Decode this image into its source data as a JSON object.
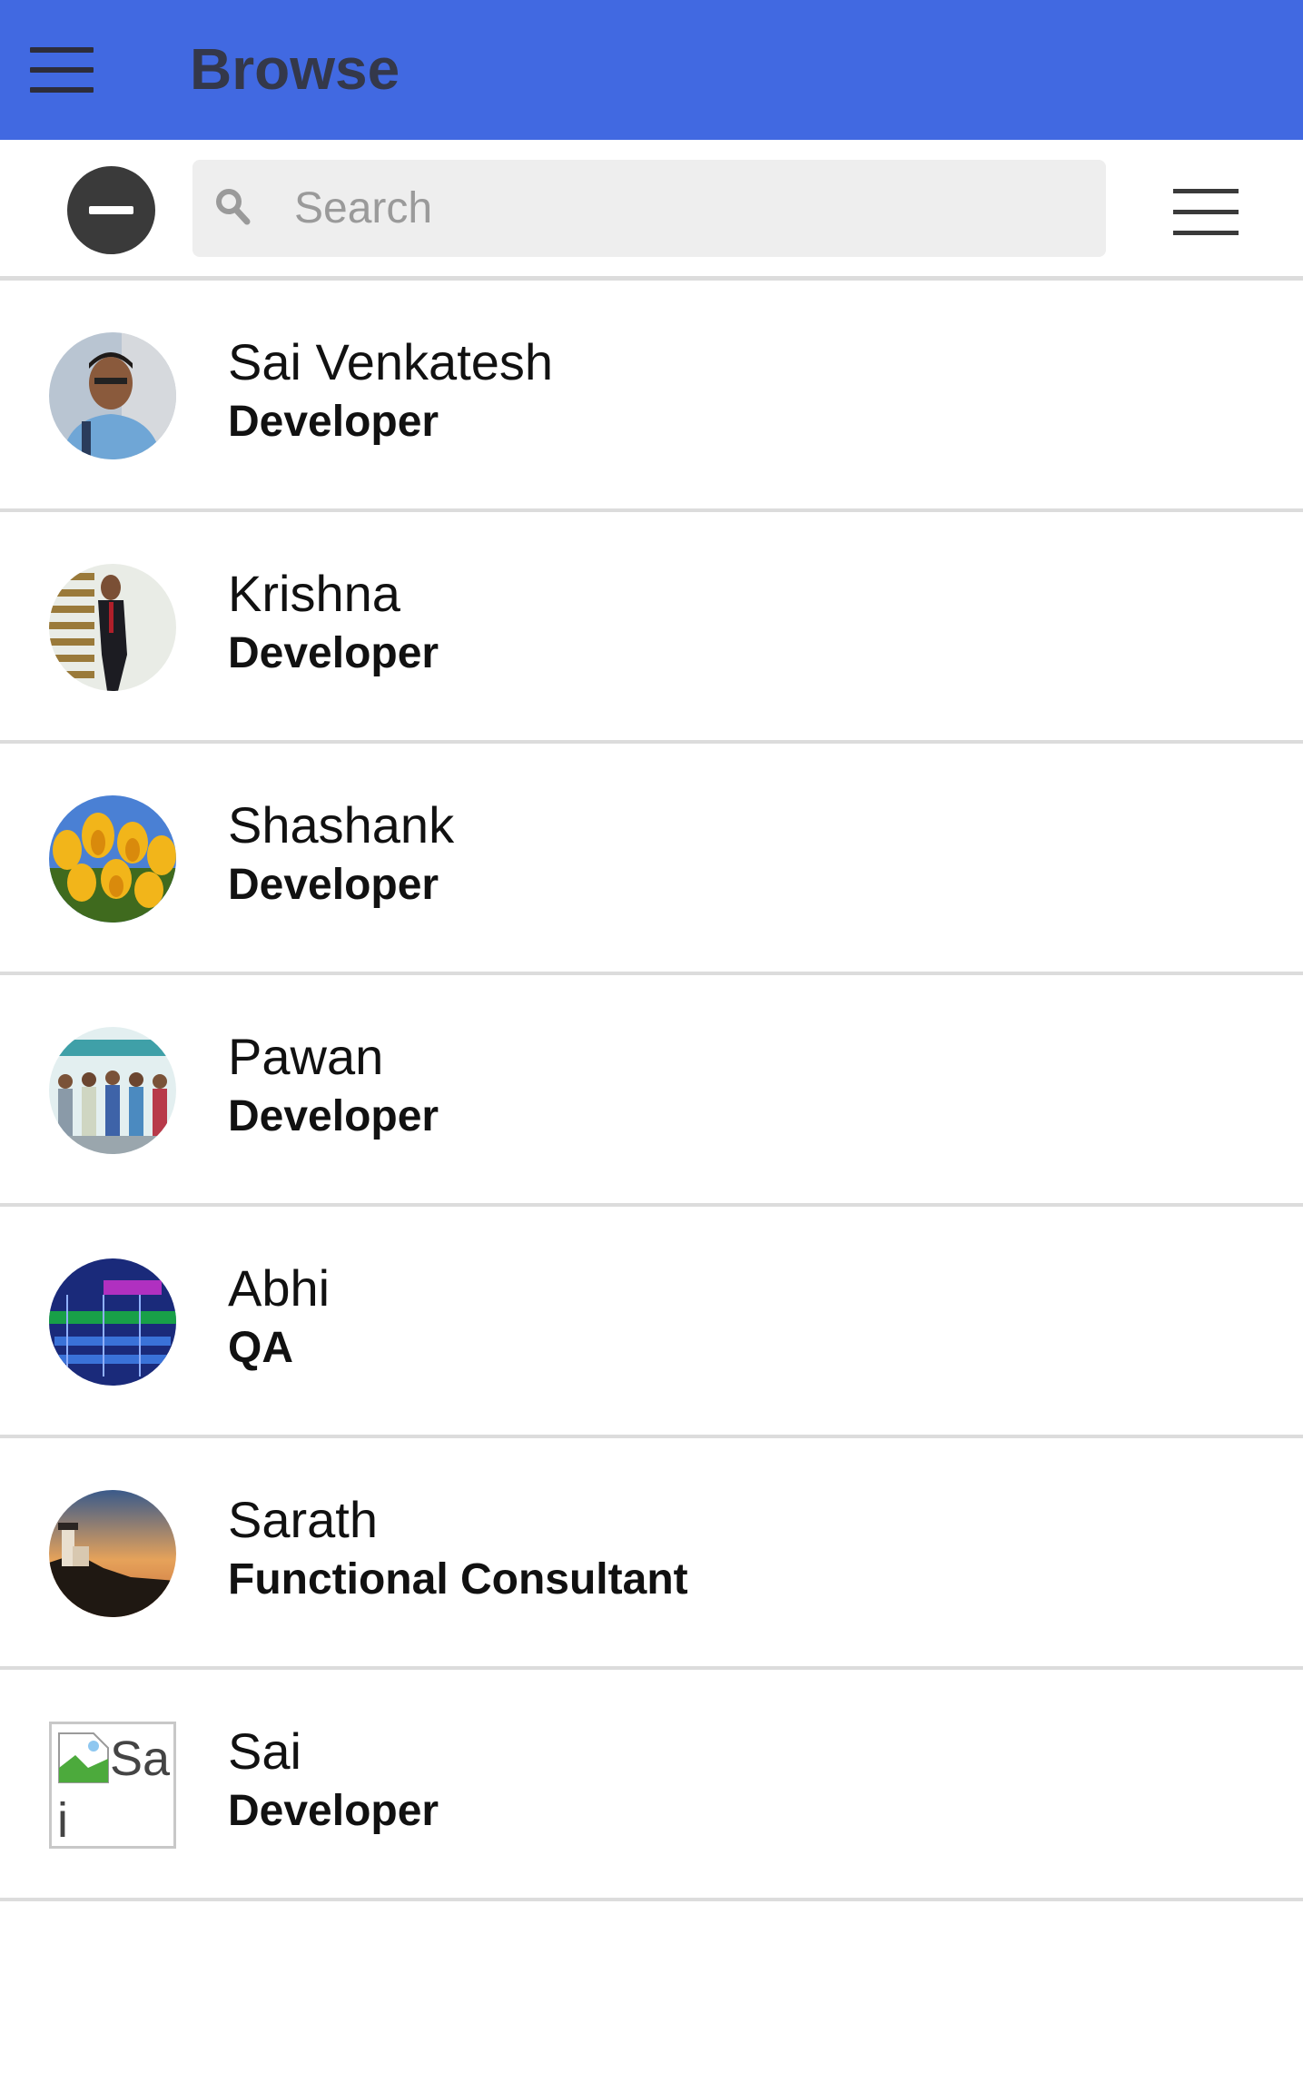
{
  "header": {
    "title": "Browse",
    "menu_icon": "hamburger-icon",
    "background_color": "#4169e1"
  },
  "toolbar": {
    "remove_icon": "minus-circle-icon",
    "search": {
      "icon": "search-icon",
      "placeholder": "Search",
      "value": ""
    },
    "list_menu_icon": "hamburger-icon"
  },
  "people": [
    {
      "name": "Sai Venkatesh",
      "role": "Developer",
      "avatar": "photo"
    },
    {
      "name": "Krishna",
      "role": "Developer",
      "avatar": "photo"
    },
    {
      "name": "Shashank",
      "role": "Developer",
      "avatar": "photo"
    },
    {
      "name": "Pawan",
      "role": "Developer",
      "avatar": "photo"
    },
    {
      "name": "Abhi",
      "role": "QA",
      "avatar": "photo"
    },
    {
      "name": "Sarath",
      "role": "Functional Consultant",
      "avatar": "photo"
    },
    {
      "name": "Sai",
      "role": "Developer",
      "avatar": "broken-image",
      "avatar_alt": "Sai"
    }
  ]
}
